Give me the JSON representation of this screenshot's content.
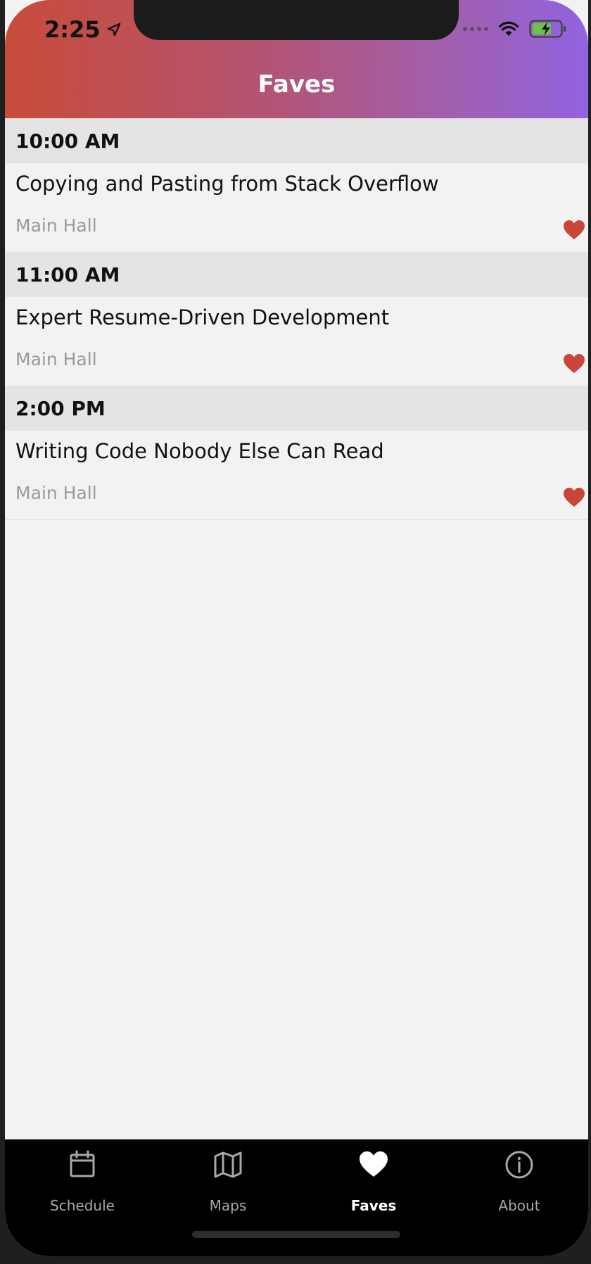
{
  "status_bar": {
    "time": "2:25"
  },
  "header": {
    "title": "Faves"
  },
  "sections": [
    {
      "time": "10:00 AM",
      "sessions": [
        {
          "title": "Copying and Pasting from Stack Overflow",
          "room": "Main Hall",
          "favorited": true
        }
      ]
    },
    {
      "time": "11:00 AM",
      "sessions": [
        {
          "title": "Expert Resume-Driven Development",
          "room": "Main Hall",
          "favorited": true
        }
      ]
    },
    {
      "time": "2:00 PM",
      "sessions": [
        {
          "title": "Writing Code Nobody Else Can Read",
          "room": "Main Hall",
          "favorited": true
        }
      ]
    }
  ],
  "tabs": [
    {
      "label": "Schedule",
      "icon": "calendar-icon",
      "active": false
    },
    {
      "label": "Maps",
      "icon": "map-icon",
      "active": false
    },
    {
      "label": "Faves",
      "icon": "heart-icon",
      "active": true
    },
    {
      "label": "About",
      "icon": "info-icon",
      "active": false
    }
  ],
  "colors": {
    "header_gradient_start": "#c84c3a",
    "header_gradient_end": "#9163e0",
    "heart": "#c8453a",
    "tab_active": "#ffffff",
    "tab_inactive": "#a8a8a8"
  }
}
